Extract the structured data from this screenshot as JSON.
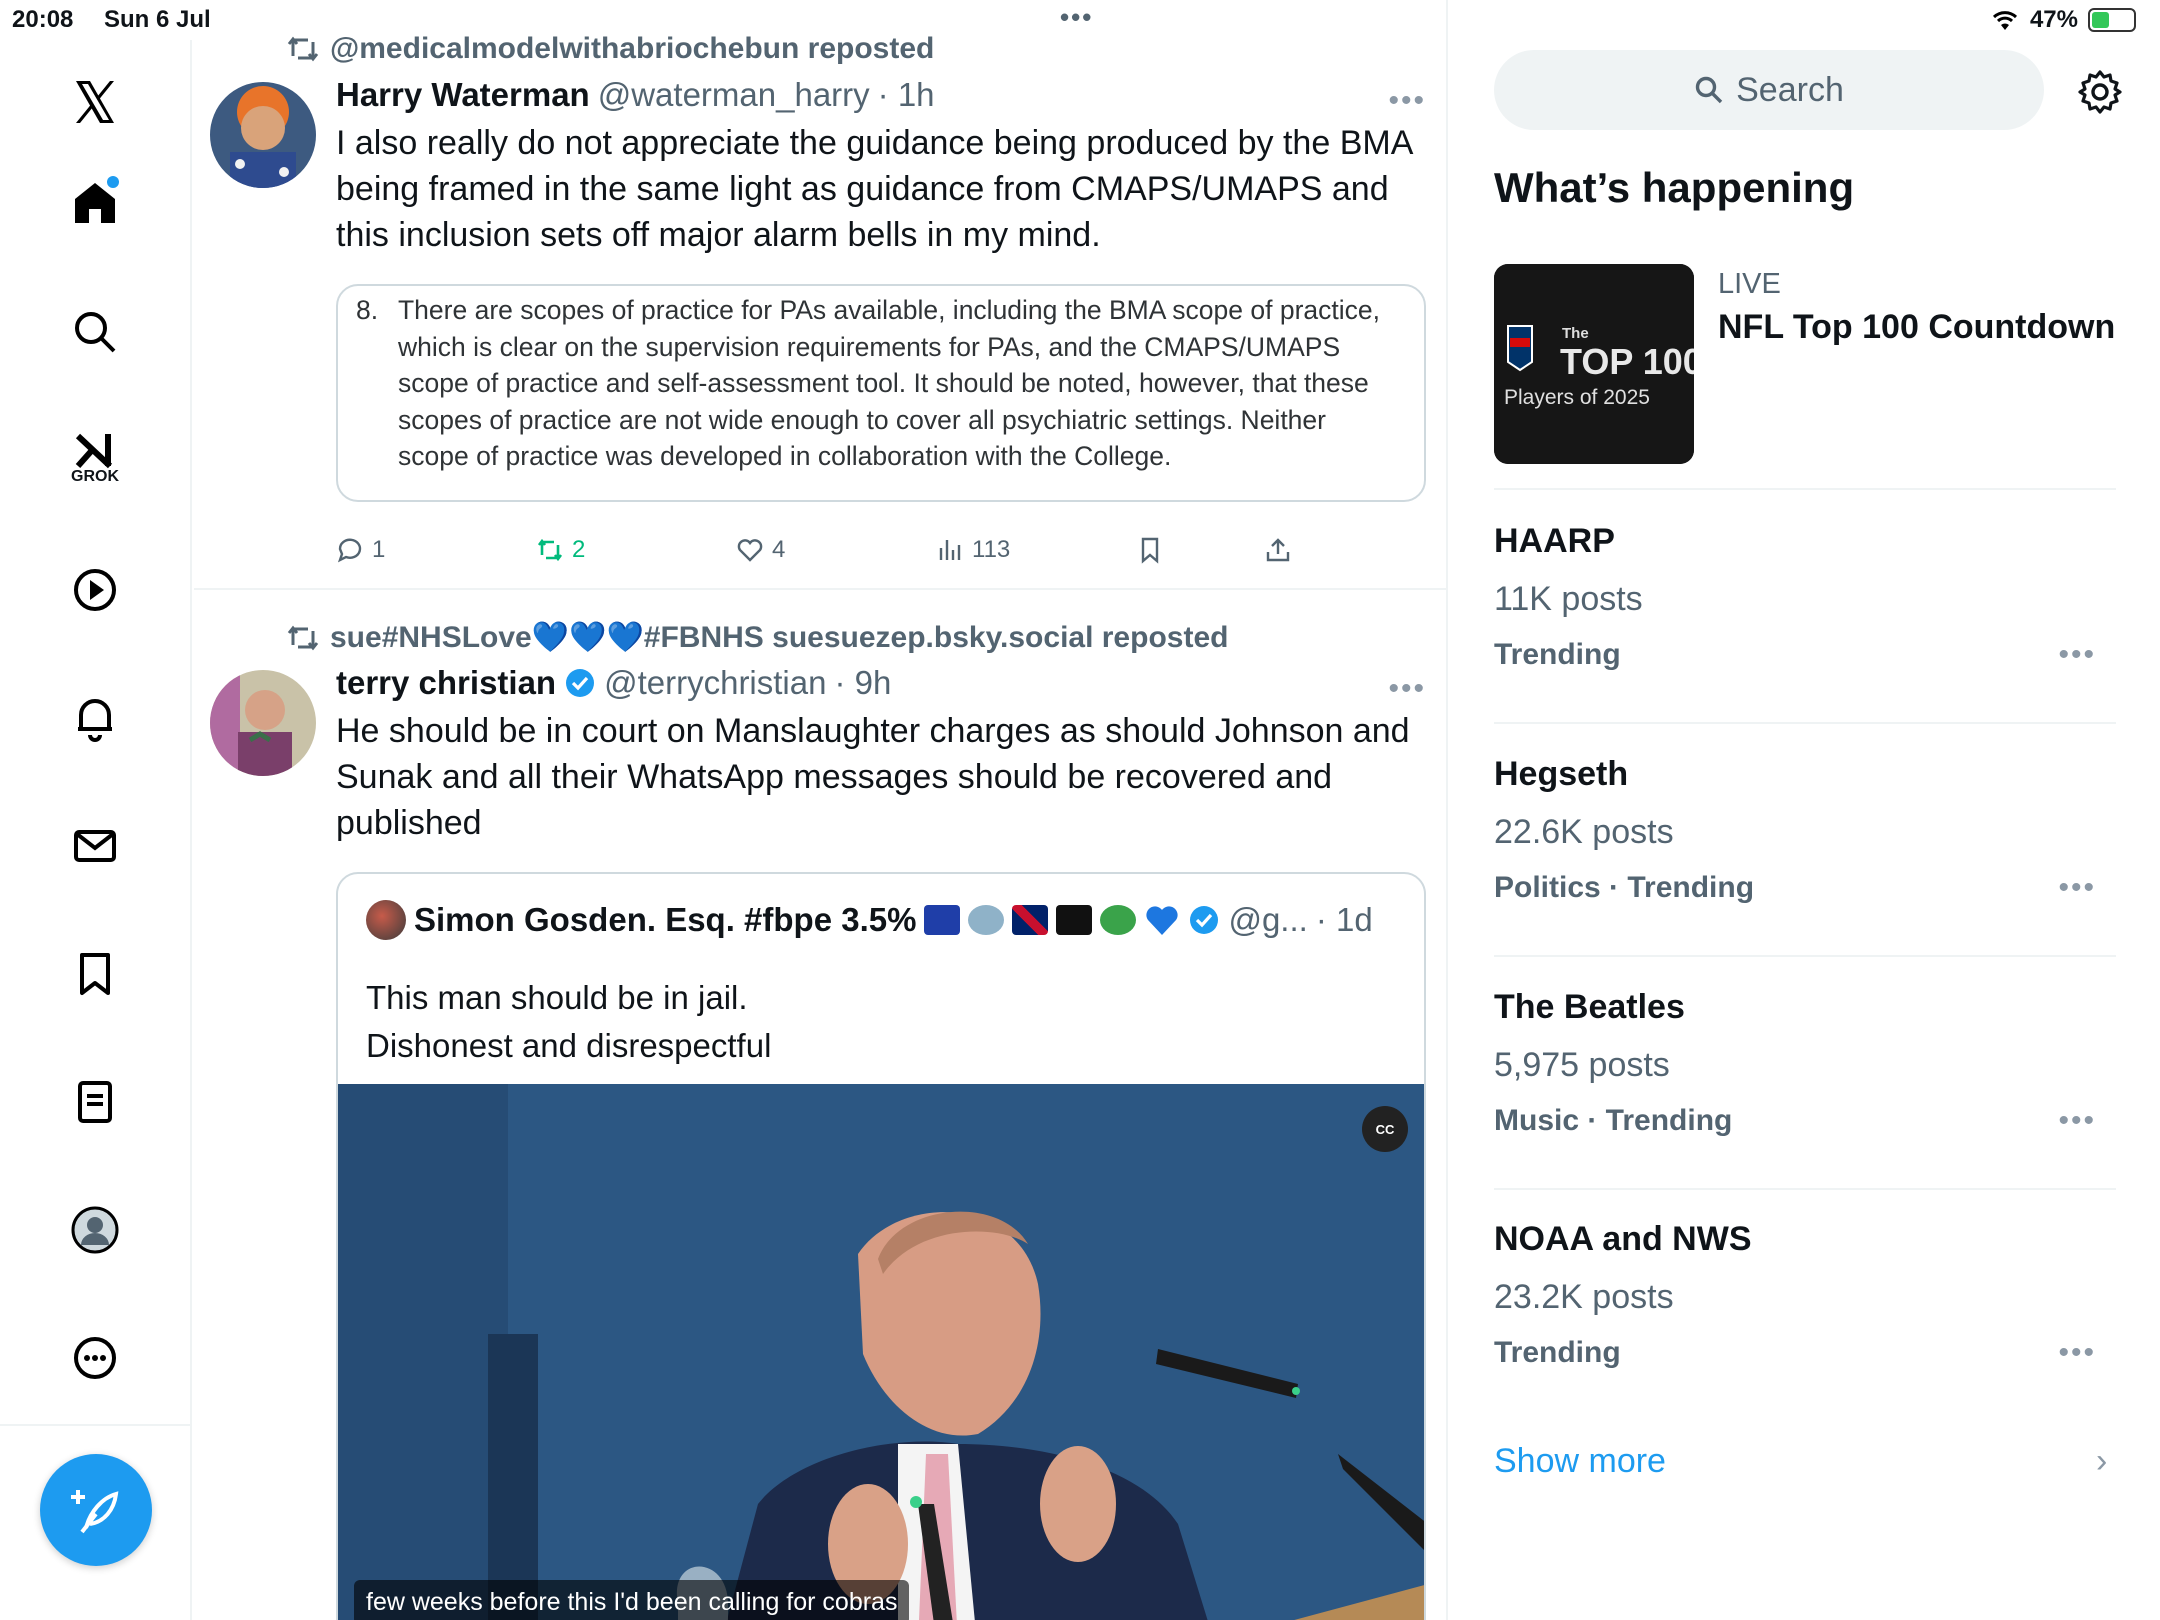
{
  "status": {
    "time": "20:08",
    "date": "Sun 6 Jul",
    "battery": "47%",
    "battery_level": 0.47
  },
  "nav": {
    "grok_label": "GROK"
  },
  "posts": [
    {
      "repost_by": "@medicalmodelwithabriochebun reposted",
      "name": "Harry Waterman",
      "handle": "@waterman_harry",
      "time": "· 1h",
      "text": "I also really do not appreciate the guidance being produced by the BMA being framed in the same light as guidance from CMAPS/UMAPS and this inclusion sets off major alarm bells in my mind.",
      "excerpt_num": "8.",
      "excerpt": "There are scopes of practice for PAs available, including the BMA scope of practice, which is clear on the supervision requirements for PAs, and the CMAPS/UMAPS scope of practice and self-assessment tool.  It should be noted, however, that these scopes of practice are not wide enough to cover all psychiatric settings. Neither scope of practice was developed in collaboration with the College.",
      "replies": "1",
      "reposts": "2",
      "likes": "4",
      "views": "113"
    },
    {
      "repost_by": "sue#NHSLove💙💙💙#FBNHS suesuezep.bsky.social reposted",
      "name": "terry christian",
      "handle": "@terrychristian",
      "time": "· 9h",
      "text": "He should be in court on Manslaughter charges as should Johnson and Sunak and all  their WhatsApp messages should be recovered and published",
      "quote": {
        "name": "Simon Gosden. Esq. #fbpe 3.5%",
        "handle": "@g...",
        "time": "· 1d",
        "text_line1": "This man should be in jail.",
        "text_line2": "Dishonest and disrespectful",
        "caption": "few weeks before this I'd been calling for cobras",
        "cc": "CC"
      }
    }
  ],
  "right": {
    "search_placeholder": "Search",
    "whats_happening": "What’s happening",
    "live": {
      "tag": "LIVE",
      "title": "NFL Top 100 Countdown",
      "img_line1": "The",
      "img_line2": "TOP 100",
      "img_line3": "Players of 2025"
    },
    "trends": [
      {
        "title": "HAARP",
        "count": "11K posts",
        "meta": "Trending"
      },
      {
        "title": "Hegseth",
        "count": "22.6K posts",
        "meta": "Politics · Trending"
      },
      {
        "title": "The Beatles",
        "count": "5,975 posts",
        "meta": "Music · Trending"
      },
      {
        "title": "NOAA and NWS",
        "count": "23.2K posts",
        "meta": "Trending"
      }
    ],
    "show_more": "Show more"
  }
}
